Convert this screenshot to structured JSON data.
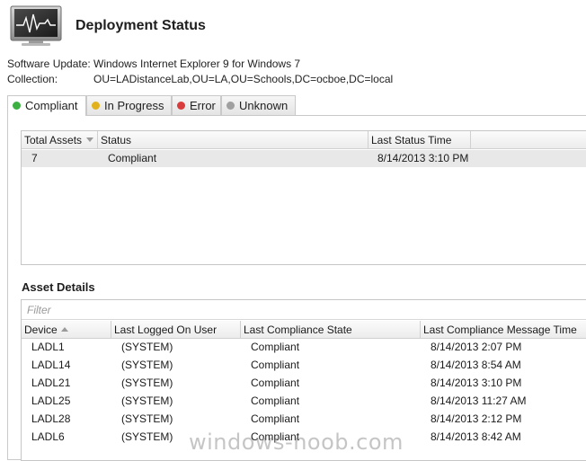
{
  "header": {
    "title": "Deployment Status",
    "icon": "monitor-heartbeat-icon"
  },
  "info": {
    "software_update_label": "Software Update:",
    "software_update_value": "Windows Internet Explorer 9 for Windows 7",
    "collection_label": "Collection:",
    "collection_value": "OU=LADistanceLab,OU=LA,OU=Schools,DC=ocboe,DC=local"
  },
  "tabs": [
    {
      "label": "Compliant",
      "color": "#3cb043",
      "active": true
    },
    {
      "label": "In Progress",
      "color": "#e2b21c",
      "active": false
    },
    {
      "label": "Error",
      "color": "#d93c3c",
      "active": false
    },
    {
      "label": "Unknown",
      "color": "#a0a0a0",
      "active": false
    }
  ],
  "summary_table": {
    "columns": [
      "Total Assets",
      "Status",
      "Last Status Time"
    ],
    "rows": [
      [
        "7",
        "Compliant",
        "8/14/2013 3:10 PM"
      ]
    ]
  },
  "asset_details": {
    "title": "Asset Details",
    "filter_placeholder": "Filter",
    "columns": [
      "Device",
      "Last Logged On User",
      "Last Compliance State",
      "Last Compliance Message Time"
    ],
    "rows": [
      [
        "LADL1",
        "(SYSTEM)",
        "Compliant",
        "8/14/2013 2:07 PM"
      ],
      [
        "LADL14",
        "(SYSTEM)",
        "Compliant",
        "8/14/2013 8:54 AM"
      ],
      [
        "LADL21",
        "(SYSTEM)",
        "Compliant",
        "8/14/2013 3:10 PM"
      ],
      [
        "LADL25",
        "(SYSTEM)",
        "Compliant",
        "8/14/2013 11:27 AM"
      ],
      [
        "LADL28",
        "(SYSTEM)",
        "Compliant",
        "8/14/2013 2:12 PM"
      ],
      [
        "LADL6",
        "(SYSTEM)",
        "Compliant",
        "8/14/2013 8:42 AM"
      ]
    ]
  },
  "watermark": "windows-noob.com"
}
